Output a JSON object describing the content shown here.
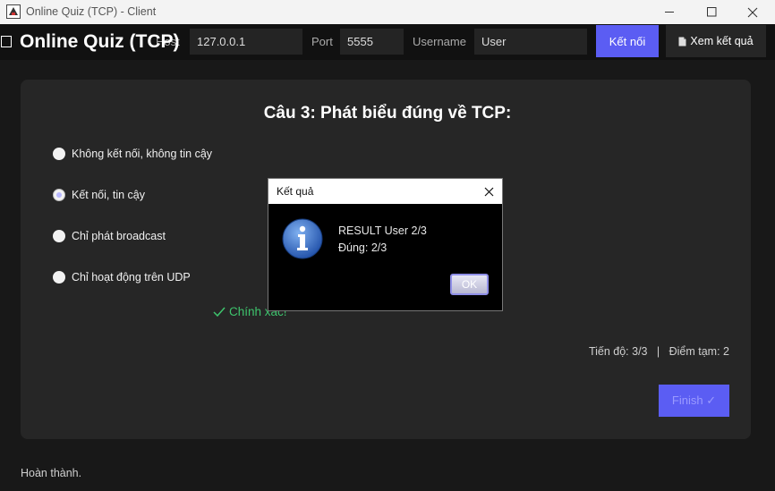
{
  "window": {
    "title": "Online Quiz (TCP) - Client"
  },
  "header": {
    "app_title": "Online Quiz (TCP)",
    "host_label": "Host",
    "host_value": "127.0.0.1",
    "port_label": "Port",
    "port_value": "5555",
    "username_label": "Username",
    "username_value": "User",
    "connect_label": "Kết nối",
    "results_label": "Xem kết quả"
  },
  "quiz": {
    "question": "Câu 3: Phát biểu đúng về TCP:",
    "options": [
      {
        "label": "Không kết nối, không tin cậy",
        "selected": false
      },
      {
        "label": "Kết nối, tin cậy",
        "selected": true
      },
      {
        "label": "Chỉ phát broadcast",
        "selected": false
      },
      {
        "label": "Chỉ hoạt động trên UDP",
        "selected": false
      }
    ],
    "feedback": "Chính xác!",
    "progress_label": "Tiến độ: 3/3",
    "score_label": "Điểm tạm: 2",
    "finish_label": "Finish ✓"
  },
  "status": "Hoàn thành.",
  "dialog": {
    "title": "Kết quả",
    "line1": "RESULT User 2/3",
    "line2": "Đúng: 2/3",
    "ok_label": "OK"
  },
  "colors": {
    "accent": "#5b5df3",
    "success": "#3ec46d",
    "background": "#181818",
    "panel": "#262626"
  },
  "icons": [
    "app-icon",
    "minimize-icon",
    "maximize-icon",
    "close-icon",
    "document-icon",
    "check-icon",
    "info-icon"
  ]
}
